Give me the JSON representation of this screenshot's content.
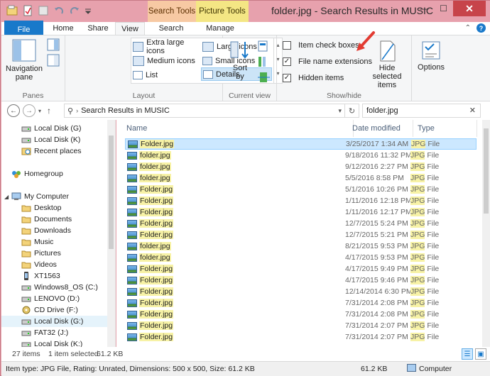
{
  "window": {
    "title": "folder.jpg - Search Results in MUSIC",
    "context_search": "Search Tools",
    "context_picture": "Picture Tools",
    "minimize": "—",
    "maximize": "☐",
    "close": "✕"
  },
  "tabs": {
    "file": "File",
    "home": "Home",
    "share": "Share",
    "view": "View",
    "search": "Search",
    "manage": "Manage"
  },
  "ribbon": {
    "panes": {
      "navigation_pane": "Navigation pane",
      "group_label": "Panes"
    },
    "layout": {
      "extra_large": "Extra large icons",
      "large": "Large icons",
      "medium": "Medium icons",
      "small": "Small icons",
      "list": "List",
      "details": "Details",
      "group_label": "Layout"
    },
    "current_view": {
      "sort_by": "Sort by",
      "group_label": "Current view"
    },
    "show_hide": {
      "item_check_boxes": "Item check boxes",
      "item_check_boxes_checked": false,
      "file_name_extensions": "File name extensions",
      "file_name_extensions_checked": true,
      "hidden_items": "Hidden items",
      "hidden_items_checked": true,
      "hide_selected_items": "Hide selected items",
      "group_label": "Show/hide"
    },
    "options": "Options"
  },
  "address": {
    "path": "Search Results in MUSIC",
    "search_value": "folder.jpg"
  },
  "nav_pane": {
    "items": [
      {
        "label": "Local Disk (G)",
        "icon": "drive-icon"
      },
      {
        "label": "Local Disk (K)",
        "icon": "drive-icon"
      },
      {
        "label": "Recent places",
        "icon": "recent-places-icon"
      },
      {
        "label": "Homegroup",
        "icon": "homegroup-icon"
      },
      {
        "label": "My Computer",
        "icon": "computer-icon"
      },
      {
        "label": "Desktop",
        "icon": "folder-icon"
      },
      {
        "label": "Documents",
        "icon": "folder-icon"
      },
      {
        "label": "Downloads",
        "icon": "folder-icon"
      },
      {
        "label": "Music",
        "icon": "folder-icon"
      },
      {
        "label": "Pictures",
        "icon": "folder-icon"
      },
      {
        "label": "Videos",
        "icon": "folder-icon"
      },
      {
        "label": "XT1563",
        "icon": "phone-icon"
      },
      {
        "label": "Windows8_OS (C:)",
        "icon": "drive-icon"
      },
      {
        "label": "LENOVO (D:)",
        "icon": "drive-icon"
      },
      {
        "label": "CD Drive (F:)",
        "icon": "cd-drive-icon"
      },
      {
        "label": "Local Disk (G:)",
        "icon": "drive-icon"
      },
      {
        "label": "FAT32 (J:)",
        "icon": "drive-icon"
      },
      {
        "label": "Local Disk (K:)",
        "icon": "drive-icon"
      }
    ]
  },
  "file_list": {
    "columns": [
      "Name",
      "Date modified",
      "Type"
    ],
    "rows": [
      {
        "name": "Folder.jpg",
        "date": "3/25/2017 1:34 AM",
        "type_hl": "JPG",
        "type_rest": " File"
      },
      {
        "name": "folder.jpg",
        "date": "9/18/2016 11:32 PM",
        "type_hl": "JPG",
        "type_rest": " File"
      },
      {
        "name": "folder.jpg",
        "date": "9/12/2016 2:27 PM",
        "type_hl": "JPG",
        "type_rest": " File"
      },
      {
        "name": "folder.jpg",
        "date": "5/5/2016 8:58 PM",
        "type_hl": "JPG",
        "type_rest": " File"
      },
      {
        "name": "Folder.jpg",
        "date": "5/1/2016 10:26 PM",
        "type_hl": "JPG",
        "type_rest": " File"
      },
      {
        "name": "Folder.jpg",
        "date": "1/11/2016 12:18 PM",
        "type_hl": "JPG",
        "type_rest": " File"
      },
      {
        "name": "Folder.jpg",
        "date": "1/11/2016 12:17 PM",
        "type_hl": "JPG",
        "type_rest": " File"
      },
      {
        "name": "Folder.jpg",
        "date": "12/7/2015 5:24 PM",
        "type_hl": "JPG",
        "type_rest": " File"
      },
      {
        "name": "Folder.jpg",
        "date": "12/7/2015 5:21 PM",
        "type_hl": "JPG",
        "type_rest": " File"
      },
      {
        "name": "folder.jpg",
        "date": "8/21/2015 9:53 PM",
        "type_hl": "JPG",
        "type_rest": " File"
      },
      {
        "name": "folder.jpg",
        "date": "4/17/2015 9:53 PM",
        "type_hl": "JPG",
        "type_rest": " File"
      },
      {
        "name": "Folder.jpg",
        "date": "4/17/2015 9:49 PM",
        "type_hl": "JPG",
        "type_rest": " File"
      },
      {
        "name": "Folder.jpg",
        "date": "4/17/2015 9:46 PM",
        "type_hl": "JPG",
        "type_rest": " File"
      },
      {
        "name": "Folder.jpg",
        "date": "12/14/2014 6:30 PM",
        "type_hl": "JPG",
        "type_rest": " File"
      },
      {
        "name": "Folder.jpg",
        "date": "7/31/2014 2:08 PM",
        "type_hl": "JPG",
        "type_rest": " File"
      },
      {
        "name": "Folder.jpg",
        "date": "7/31/2014 2:08 PM",
        "type_hl": "JPG",
        "type_rest": " File"
      },
      {
        "name": "Folder.jpg",
        "date": "7/31/2014 2:07 PM",
        "type_hl": "JPG",
        "type_rest": " File"
      },
      {
        "name": "Folder.jpg",
        "date": "7/31/2014 2:07 PM",
        "type_hl": "JPG",
        "type_rest": " File"
      }
    ],
    "selected_index": 0
  },
  "status": {
    "item_count": "27 items",
    "selected": "1 item selected",
    "selected_size": "61.2 KB"
  },
  "details_bar": {
    "info": "Item type: JPG File, Rating: Unrated, Dimensions: 500 x 500, Size: 61.2 KB",
    "size": "61.2 KB",
    "location": "Computer"
  },
  "colors": {
    "title_bar": "#e7a1ad",
    "file_tab": "#1979ca",
    "search_tools": "#f7c9a3",
    "picture_tools": "#f4e684",
    "selection": "#cce8ff",
    "search_highlight": "#f7f2a6",
    "annotation_arrow": "#e23b32"
  }
}
